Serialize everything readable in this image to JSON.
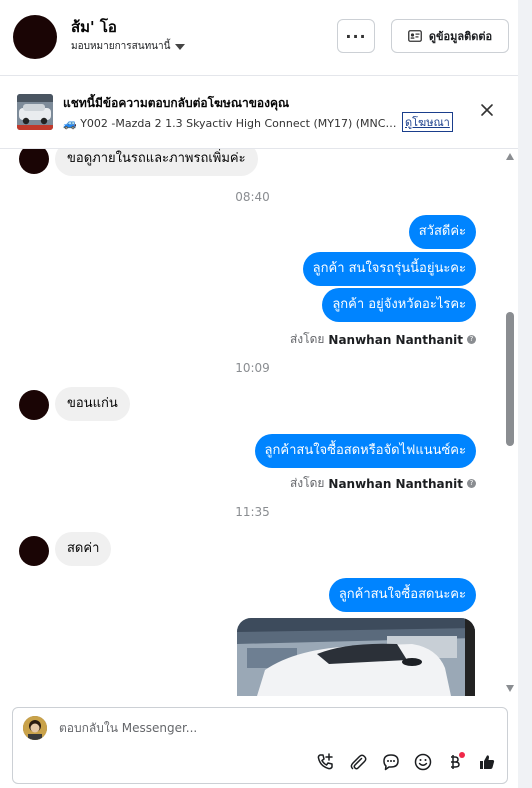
{
  "header": {
    "name": "ส้ม' โอ",
    "assign_label": "มอบหมายการสนทนานี้",
    "more_label": "···",
    "contact_button": "ดูข้อมูลติดต่อ"
  },
  "ad_banner": {
    "title": "แชทนี้มีข้อความตอบกลับต่อโฆษณาของคุณ",
    "description": "🚙 Y002 -Mazda 2 1.3 Skyactiv High Connect (MY17) (MNC) ATปี...",
    "link_label": "ดูโฆษณา"
  },
  "messages": {
    "m1": "ขอดูภายในรถและภาพรถเพิ่มค่ะ",
    "t1": "08:40",
    "m2": "สวัสดีค่ะ",
    "m3": "ลูกค้า สนใจรถรุ่นนี้อยู่นะคะ",
    "m4": "ลูกค้า อยู่จังหวัดอะไรคะ",
    "sent_by_prefix": "ส่งโดย",
    "sender": "Nanwhan Nanthanit",
    "t2": "10:09",
    "m5": "ขอนแก่น",
    "m6": "ลูกค้าสนใจซื้อสดหรือจัดไฟแนนซ์คะ",
    "t3": "11:35",
    "m7": "สดค่า",
    "m8": "ลูกค้าสนใจซื้อสดนะคะ"
  },
  "composer": {
    "placeholder": "ตอบกลับใน Messenger..."
  },
  "icons": {
    "more": "more-icon",
    "contact": "contact-card-icon",
    "close": "close-icon",
    "call": "call-add-icon",
    "attach": "paperclip-icon",
    "saved_reply": "chat-bubble-icon",
    "emoji": "emoji-icon",
    "payment": "baht-icon",
    "like": "thumbs-up-icon"
  },
  "colors": {
    "accent": "#0084ff",
    "incoming_bubble": "#f0f0f0",
    "notification_dot": "#f02849"
  }
}
